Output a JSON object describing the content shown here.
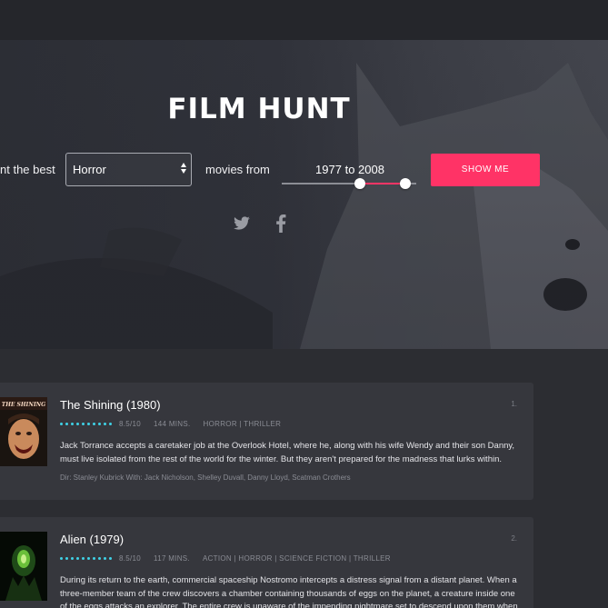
{
  "app": {
    "title": "FILM HUNT"
  },
  "search": {
    "lead_text": "nt the best",
    "genre_selected": "Horror",
    "from_text": "movies from",
    "year_range_text": "1977 to 2008",
    "range_low_fraction": 0.58,
    "range_high_fraction": 0.92,
    "button_label": "SHOW ME"
  },
  "colors": {
    "accent": "#ff3366",
    "rating_dots": "#3fd1e6",
    "background": "#2b2c31",
    "card": "#36373d"
  },
  "social": [
    "twitter-icon",
    "facebook-icon"
  ],
  "movies": [
    {
      "rank": "1.",
      "title": "The Shining (1980)",
      "rating": "8.5/10",
      "length": "144 MINS.",
      "genres": "HORROR | THRILLER",
      "plot": "Jack Torrance accepts a caretaker job at the Overlook Hotel, where he, along with his wife Wendy and their son Danny, must live isolated from the rest of the world for the winter. But they aren't prepared for the madness that lurks within.",
      "credits": "Dir: Stanley Kubrick With: Jack Nicholson, Shelley Duvall, Danny Lloyd, Scatman Crothers",
      "poster_text": "THE SHINING"
    },
    {
      "rank": "2.",
      "title": "Alien (1979)",
      "rating": "8.5/10",
      "length": "117 MINS.",
      "genres": "ACTION | HORROR | SCIENCE FICTION | THRILLER",
      "plot": "During its return to the earth, commercial spaceship Nostromo intercepts a distress signal from a distant planet. When a three-member team of the crew discovers a chamber containing thousands of eggs on the planet, a creature inside one of the eggs attacks an explorer. The entire crew is unaware of the impending nightmare set to descend upon them when"
    }
  ]
}
